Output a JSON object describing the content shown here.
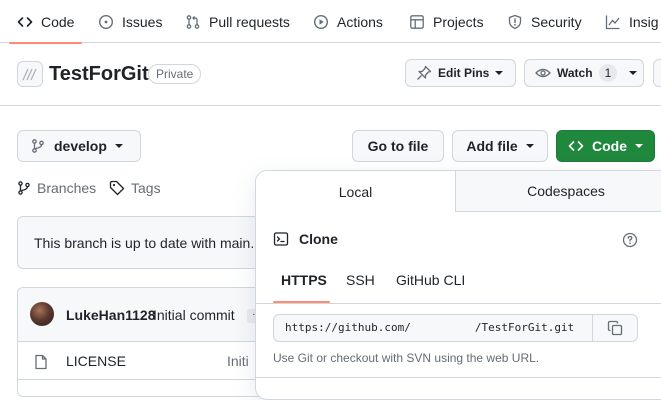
{
  "nav": {
    "tabs": [
      {
        "label": "Code",
        "icon": "code-icon",
        "active": true
      },
      {
        "label": "Issues",
        "icon": "issue-icon"
      },
      {
        "label": "Pull requests",
        "icon": "pull-request-icon"
      },
      {
        "label": "Actions",
        "icon": "play-icon"
      },
      {
        "label": "Projects",
        "icon": "table-icon"
      },
      {
        "label": "Security",
        "icon": "shield-icon"
      },
      {
        "label": "Insig",
        "icon": "graph-icon"
      }
    ]
  },
  "repo": {
    "name": "TestForGit",
    "visibility": "Private",
    "edit_pins_label": "Edit Pins",
    "watch_label": "Watch",
    "watch_count": "1"
  },
  "toolbar": {
    "branch": "develop",
    "go_to_file": "Go to file",
    "add_file": "Add file",
    "code": "Code",
    "branches_label": "Branches",
    "tags_label": "Tags"
  },
  "status": {
    "message": "This branch is up to date with main."
  },
  "commit": {
    "author": "LukeHan1128",
    "message": "Initial commit",
    "ellipsis": "…"
  },
  "files": [
    {
      "name": "LICENSE",
      "commit": "Initi"
    }
  ],
  "clone_popover": {
    "tabs": [
      "Local",
      "Codespaces"
    ],
    "clone_title": "Clone",
    "protocols": [
      "HTTPS",
      "SSH",
      "GitHub CLI"
    ],
    "active_protocol": "HTTPS",
    "url_prefix": "https://github.com/",
    "url_suffix": "/TestForGit.git",
    "hint": "Use Git or checkout with SVN using the web URL."
  },
  "colors": {
    "accent_underline": "#fd8c73",
    "primary_green": "#1f883d",
    "border": "#d0d7de",
    "muted_text": "#656d76"
  }
}
